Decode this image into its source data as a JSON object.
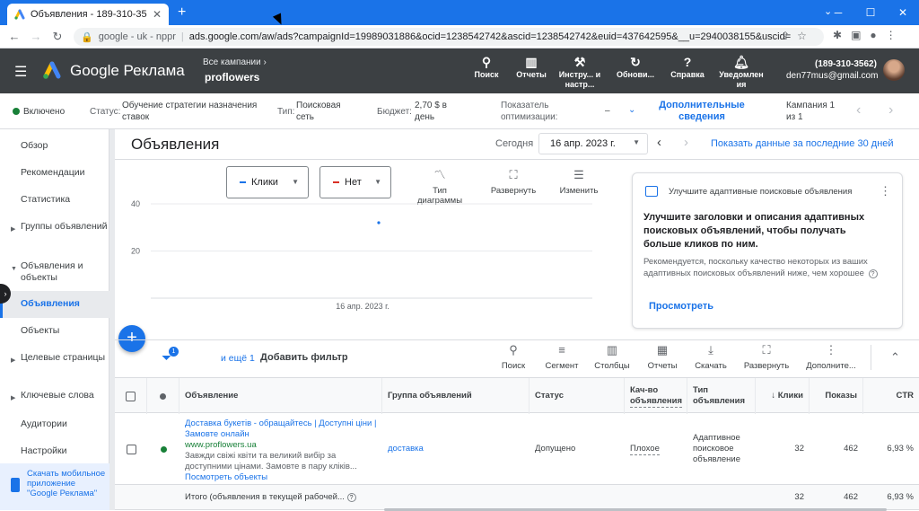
{
  "browser": {
    "tab_title": "Объявления - 189-310-3562 - G",
    "tab_close": "✕",
    "new_tab": "+",
    "window_controls": [
      "─",
      "☐",
      "✕"
    ],
    "url_host": "google - uk - nppr",
    "url": "ads.google.com/aw/ads?campaignId=19989031886&ocid=1238542742&ascid=1238542742&euid=437642595&__u=2940038155&uscid="
  },
  "header": {
    "brand": "Google Реклама",
    "crumb": "Все кампании",
    "campaign_name": "proflowers",
    "tools": [
      {
        "label": "Поиск",
        "icon": "search-icon"
      },
      {
        "label": "Отчеты",
        "icon": "reports-icon"
      },
      {
        "label": "Инстру... и настр...",
        "icon": "wrench-icon"
      },
      {
        "label": "Обнови...",
        "icon": "refresh-icon"
      },
      {
        "label": "Справка",
        "icon": "help-icon"
      },
      {
        "label": "Уведомлен ия",
        "icon": "bell-icon"
      }
    ],
    "account_phone": "(189-310-3562)",
    "account_email": "den77mus@gmail.com"
  },
  "status_bar": {
    "enabled": "Включено",
    "status_label": "Статус:",
    "status_value": "Обучение стратегии назначения ставок",
    "type_label": "Тип:",
    "type_value": "Поисковая сеть",
    "budget_label": "Бюджет:",
    "budget_value": "2,70 $ в день",
    "opt_label": "Показатель оптимизации:",
    "opt_value": "–",
    "more_info": "Дополнительные сведения",
    "campaign_pos": "Кампания 1 из 1"
  },
  "sidebar": {
    "items": [
      {
        "label": "Обзор"
      },
      {
        "label": "Рекомендации"
      },
      {
        "label": "Статистика"
      },
      {
        "label": "Группы объявлений"
      },
      {
        "label": "Объявления и объекты"
      },
      {
        "label": "Объявления"
      },
      {
        "label": "Объекты"
      },
      {
        "label": "Целевые страницы"
      },
      {
        "label": "Ключевые слова"
      },
      {
        "label": "Аудитории"
      },
      {
        "label": "Настройки"
      }
    ],
    "mobile_promo": "Скачать мобильное приложение \"Google Реклама\""
  },
  "main": {
    "title": "Объявления",
    "today": "Сегодня",
    "date": "16 апр. 2023 г.",
    "last30": "Показать данные за последние 30 дней"
  },
  "chart": {
    "metric1": "Клики",
    "metric1_color": "#1a73e8",
    "metric2": "Нет",
    "metric2_color": "#d93025",
    "tools": [
      {
        "label": "Тип диаграммы",
        "icon": "chart-type-icon"
      },
      {
        "label": "Развернуть",
        "icon": "expand-icon"
      },
      {
        "label": "Изменить",
        "icon": "tune-icon"
      }
    ]
  },
  "chart_data": {
    "type": "scatter",
    "x": [
      "16 апр. 2023 г."
    ],
    "series": [
      {
        "values": [
          32
        ]
      }
    ],
    "yticks": [
      40,
      20
    ],
    "ylim": [
      0,
      40
    ],
    "grid": true
  },
  "reco": {
    "header": "Улучшите адаптивные поисковые объявления",
    "headline": "Улучшите заголовки и описания адаптивных поисковых объявлений, чтобы получать больше кликов по ним.",
    "desc": "Рекомендуется, поскольку качество некоторых из ваших адаптивных поисковых объявлений ниже, чем хорошее",
    "view": "Просмотреть"
  },
  "filters": {
    "badge": "1",
    "more": "и ещё 1",
    "add": "Добавить фильтр"
  },
  "table_tools": [
    {
      "label": "Поиск",
      "icon": "search-icon"
    },
    {
      "label": "Сегмент",
      "icon": "segment-icon"
    },
    {
      "label": "Столбцы",
      "icon": "columns-icon"
    },
    {
      "label": "Отчеты",
      "icon": "reports-icon"
    },
    {
      "label": "Скачать",
      "icon": "download-icon"
    },
    {
      "label": "Развернуть",
      "icon": "expand-icon"
    },
    {
      "label": "Дополните...",
      "icon": "more-icon"
    }
  ],
  "table": {
    "headers": {
      "ad": "Объявление",
      "group": "Группа объявлений",
      "status": "Статус",
      "quality": "Кач-во объявления",
      "type": "Тип объявления",
      "clicks": "Клики",
      "impressions": "Показы",
      "ctr": "CTR"
    },
    "row": {
      "title": "Доставка букетів - обращайтесь | Доступні ціни | Замовте онлайн",
      "display_url": "www.proflowers.ua",
      "desc": "Завжди свіжі квіти та великий вибір за доступними цінами. Замовте в пару кліків...",
      "view_ads": "Посмотреть объекты",
      "group": "доставка",
      "status": "Допущено",
      "quality": "Плохое",
      "type": "Адаптивное поисковое объявление",
      "clicks": "32",
      "impressions": "462",
      "ctr": "6,93 %"
    },
    "total": {
      "label": "Итого (объявления в текущей рабочей...",
      "clicks": "32",
      "impressions": "462",
      "ctr": "6,93 %"
    }
  }
}
